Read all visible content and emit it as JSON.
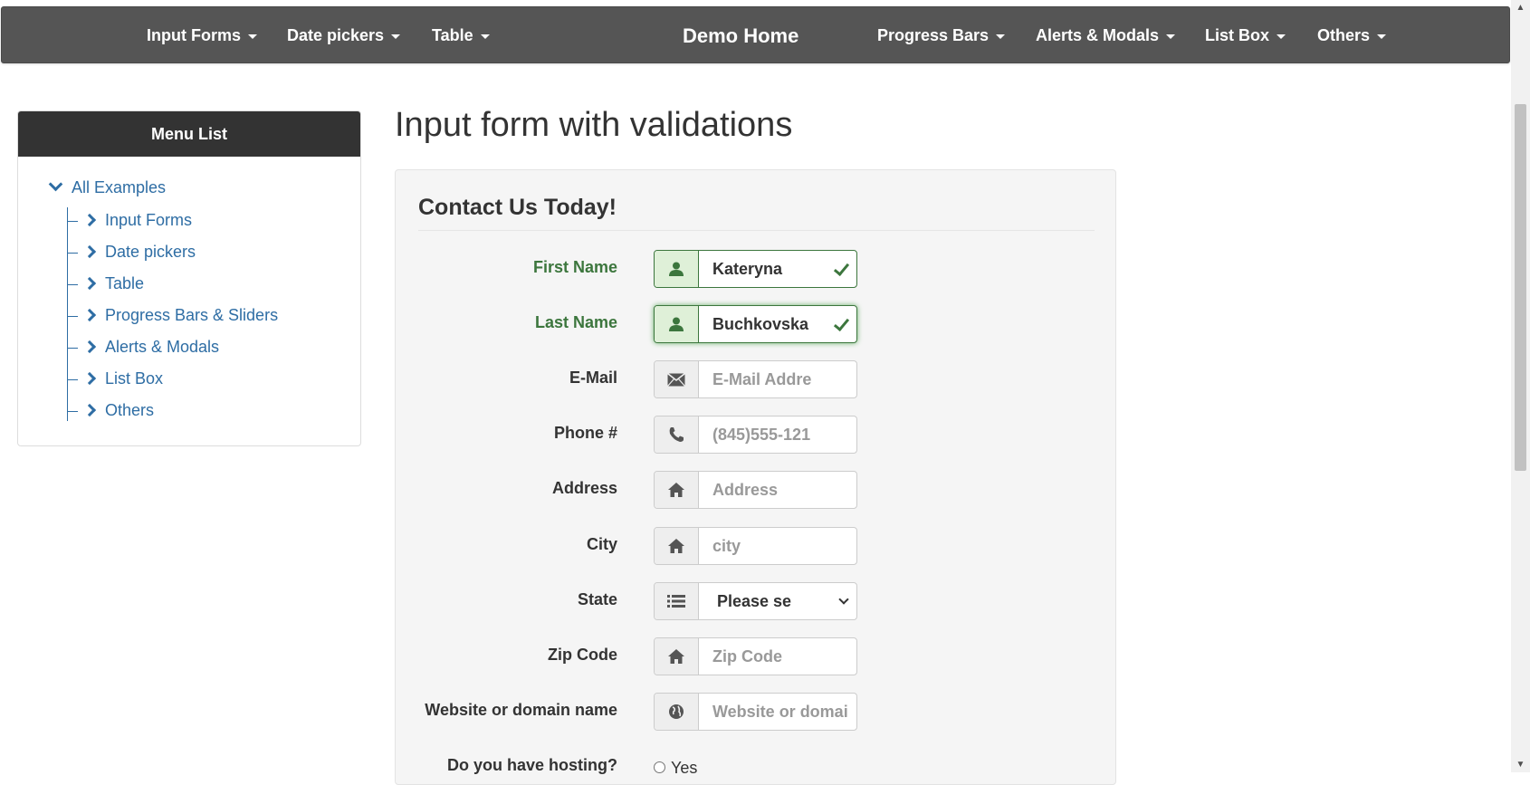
{
  "navbar": {
    "left_items": [
      "Input Forms",
      "Date pickers",
      "Table"
    ],
    "brand": "Demo Home",
    "right_items": [
      "Progress Bars",
      "Alerts & Modals",
      "List Box",
      "Others"
    ]
  },
  "sidebar": {
    "title": "Menu List",
    "root": "All Examples",
    "items": [
      "Input Forms",
      "Date pickers",
      "Table",
      "Progress Bars & Sliders",
      "Alerts & Modals",
      "List Box",
      "Others"
    ]
  },
  "main": {
    "title": "Input form with validations",
    "form_title": "Contact Us Today!",
    "fields": {
      "first_name": {
        "label": "First Name",
        "value": "Kateryna",
        "icon": "user-icon"
      },
      "last_name": {
        "label": "Last Name",
        "value": "Buchkovska",
        "icon": "user-icon"
      },
      "email": {
        "label": "E-Mail",
        "placeholder": "E-Mail Addre",
        "icon": "envelope-icon"
      },
      "phone": {
        "label": "Phone #",
        "placeholder": "(845)555-121",
        "icon": "phone-icon"
      },
      "address": {
        "label": "Address",
        "placeholder": "Address",
        "icon": "home-icon"
      },
      "city": {
        "label": "City",
        "placeholder": "city",
        "icon": "home-icon"
      },
      "state": {
        "label": "State",
        "value": "Please se",
        "icon": "list-icon"
      },
      "zip": {
        "label": "Zip Code",
        "placeholder": "Zip Code",
        "icon": "home-icon"
      },
      "website": {
        "label": "Website or domain name",
        "placeholder": "Website or domai",
        "icon": "globe-icon"
      },
      "hosting": {
        "label": "Do you have hosting?",
        "option_yes": "Yes"
      }
    }
  },
  "colors": {
    "navbar": "#555555",
    "link": "#2e6da4",
    "success": "#3c763d",
    "panel": "#f5f5f5"
  }
}
